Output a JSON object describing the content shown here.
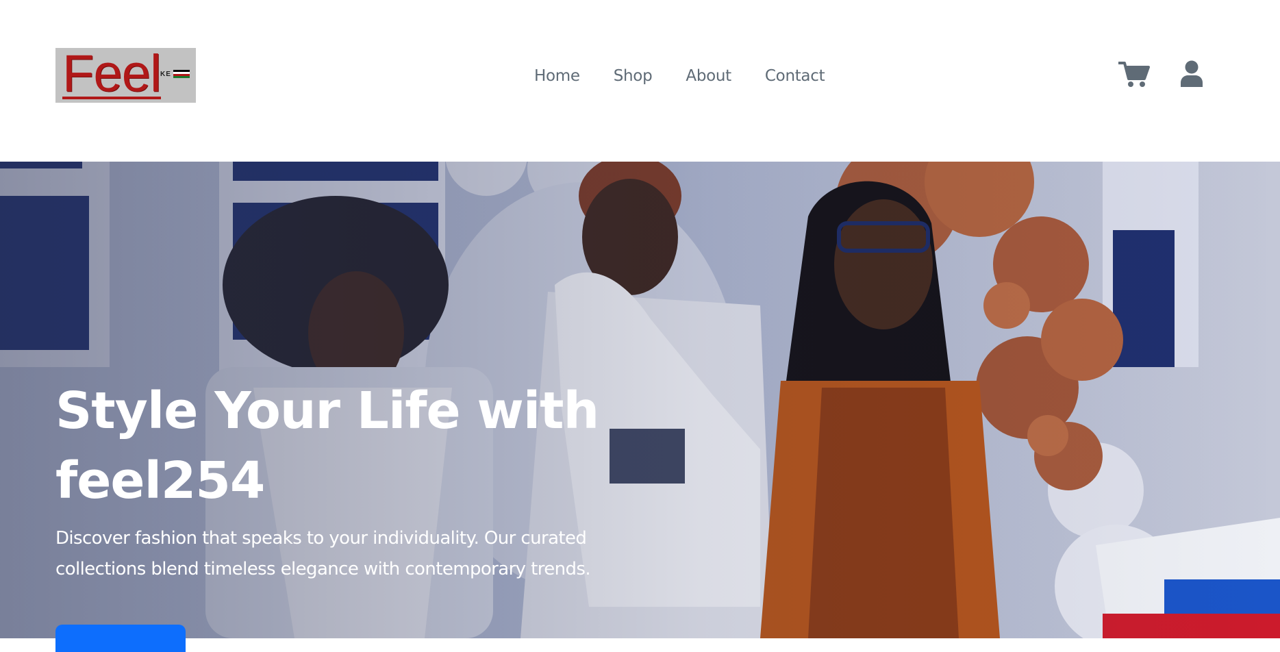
{
  "brand": {
    "logo_word": "Feel",
    "logo_country": "KE",
    "logo_bg": "#c2c2c2",
    "logo_color": "#b01818"
  },
  "nav": {
    "items": [
      {
        "label": "Home"
      },
      {
        "label": "Shop"
      },
      {
        "label": "About"
      },
      {
        "label": "Contact"
      }
    ],
    "color": "#5f6b76"
  },
  "actions": {
    "cart_icon": "shopping-cart-icon",
    "user_icon": "user-icon",
    "icon_color": "#5f6b76"
  },
  "hero": {
    "title": "Style Your Life with feel254",
    "subtitle": "Discover fashion that speaks to your individuality. Our curated collections blend timeless elegance with contemporary trends.",
    "cta_color": "#0d6efd",
    "image": "three women holding white hoodies in front of balloon wall"
  }
}
